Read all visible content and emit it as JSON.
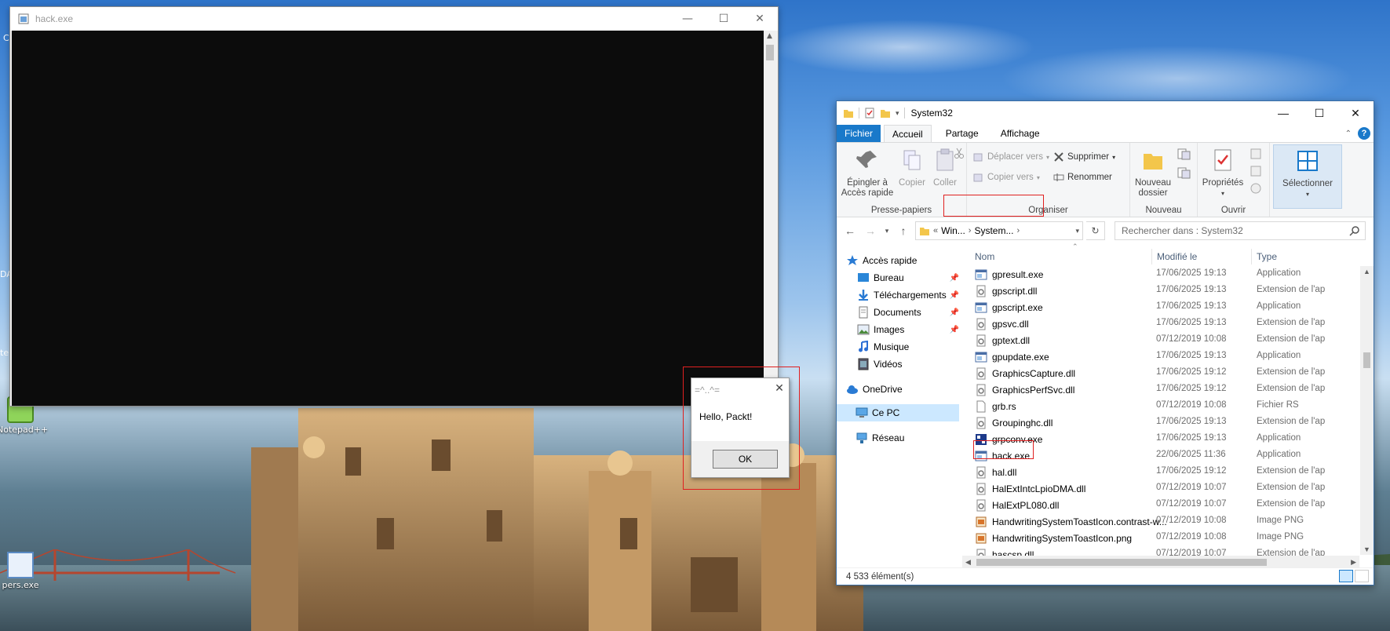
{
  "desktop": {
    "icons": [
      {
        "label": "Notepad++",
        "icon": "notepad-plus-icon"
      },
      {
        "label": "pers.exe",
        "icon": "exe-icon"
      }
    ],
    "left_edge_labels": [
      "C",
      "DA",
      "te"
    ]
  },
  "console": {
    "title": "hack.exe",
    "controls": {
      "minimize": "—",
      "maximize": "☐",
      "close": "✕"
    }
  },
  "messagebox": {
    "title": "=^..^=",
    "message": "Hello, Packt!",
    "ok_label": "OK",
    "close": "✕"
  },
  "explorer": {
    "title": "System32",
    "controls": {
      "minimize": "—",
      "maximize": "☐",
      "close": "✕"
    },
    "tabs": [
      "Fichier",
      "Accueil",
      "Partage",
      "Affichage"
    ],
    "active_tab": "Accueil",
    "help": "?",
    "ribbon": {
      "presse_papiers": {
        "label": "Presse-papiers",
        "pin_line1": "Épingler à",
        "pin_line2": "Accès rapide",
        "copy": "Copier",
        "paste": "Coller"
      },
      "organiser": {
        "label": "Organiser",
        "move_to": "Déplacer vers",
        "copy_to": "Copier vers",
        "delete": "Supprimer",
        "rename": "Renommer"
      },
      "nouveau": {
        "label": "Nouveau",
        "new_folder_line1": "Nouveau",
        "new_folder_line2": "dossier"
      },
      "ouvrir": {
        "label": "Ouvrir",
        "properties": "Propriétés"
      },
      "selectionner": {
        "label": "Sélectionner"
      }
    },
    "address": {
      "prefix": "«",
      "crumbs": [
        "Win...",
        "System..."
      ],
      "search_placeholder": "Rechercher dans : System32"
    },
    "nav": {
      "quick_access": "Accès rapide",
      "items": [
        {
          "label": "Bureau",
          "icon": "desktop-folder-icon",
          "pinned": true
        },
        {
          "label": "Téléchargements",
          "icon": "downloads-icon",
          "pinned": true
        },
        {
          "label": "Documents",
          "icon": "documents-icon",
          "pinned": true
        },
        {
          "label": "Images",
          "icon": "images-icon",
          "pinned": true
        },
        {
          "label": "Musique",
          "icon": "music-icon",
          "pinned": false
        },
        {
          "label": "Vidéos",
          "icon": "videos-icon",
          "pinned": false
        }
      ],
      "onedrive": "OneDrive",
      "this_pc": "Ce PC",
      "network": "Réseau"
    },
    "columns": {
      "name": "Nom",
      "modified": "Modifié le",
      "type": "Type"
    },
    "files": [
      {
        "name": "gpresult.exe",
        "date": "17/06/2025 19:13",
        "type": "Application",
        "icon": "app"
      },
      {
        "name": "gpscript.dll",
        "date": "17/06/2025 19:13",
        "type": "Extension de l'ap",
        "icon": "dll"
      },
      {
        "name": "gpscript.exe",
        "date": "17/06/2025 19:13",
        "type": "Application",
        "icon": "app"
      },
      {
        "name": "gpsvc.dll",
        "date": "17/06/2025 19:13",
        "type": "Extension de l'ap",
        "icon": "dll"
      },
      {
        "name": "gptext.dll",
        "date": "07/12/2019 10:08",
        "type": "Extension de l'ap",
        "icon": "dll"
      },
      {
        "name": "gpupdate.exe",
        "date": "17/06/2025 19:13",
        "type": "Application",
        "icon": "app"
      },
      {
        "name": "GraphicsCapture.dll",
        "date": "17/06/2025 19:12",
        "type": "Extension de l'ap",
        "icon": "dll"
      },
      {
        "name": "GraphicsPerfSvc.dll",
        "date": "17/06/2025 19:12",
        "type": "Extension de l'ap",
        "icon": "dll"
      },
      {
        "name": "grb.rs",
        "date": "07/12/2019 10:08",
        "type": "Fichier RS",
        "icon": "file"
      },
      {
        "name": "Groupinghc.dll",
        "date": "17/06/2025 19:13",
        "type": "Extension de l'ap",
        "icon": "dll"
      },
      {
        "name": "grpconv.exe",
        "date": "17/06/2025 19:13",
        "type": "Application",
        "icon": "grpconv"
      },
      {
        "name": "hack.exe",
        "date": "22/06/2025 11:36",
        "type": "Application",
        "icon": "app"
      },
      {
        "name": "hal.dll",
        "date": "17/06/2025 19:12",
        "type": "Extension de l'ap",
        "icon": "dll"
      },
      {
        "name": "HalExtIntcLpioDMA.dll",
        "date": "07/12/2019 10:07",
        "type": "Extension de l'ap",
        "icon": "dll"
      },
      {
        "name": "HalExtPL080.dll",
        "date": "07/12/2019 10:07",
        "type": "Extension de l'ap",
        "icon": "dll"
      },
      {
        "name": "HandwritingSystemToastIcon.contrast-w...",
        "date": "07/12/2019 10:08",
        "type": "Image PNG",
        "icon": "png"
      },
      {
        "name": "HandwritingSystemToastIcon.png",
        "date": "07/12/2019 10:08",
        "type": "Image PNG",
        "icon": "png"
      },
      {
        "name": "hascsp.dll",
        "date": "07/12/2019 10:07",
        "type": "Extension de l'ap",
        "icon": "dll"
      }
    ],
    "status": "4 533 élément(s)"
  },
  "colors": {
    "accent": "#1979ca",
    "highlight_red": "#e02020",
    "console_bg": "#0c0c0c",
    "selection": "#cce8ff"
  }
}
